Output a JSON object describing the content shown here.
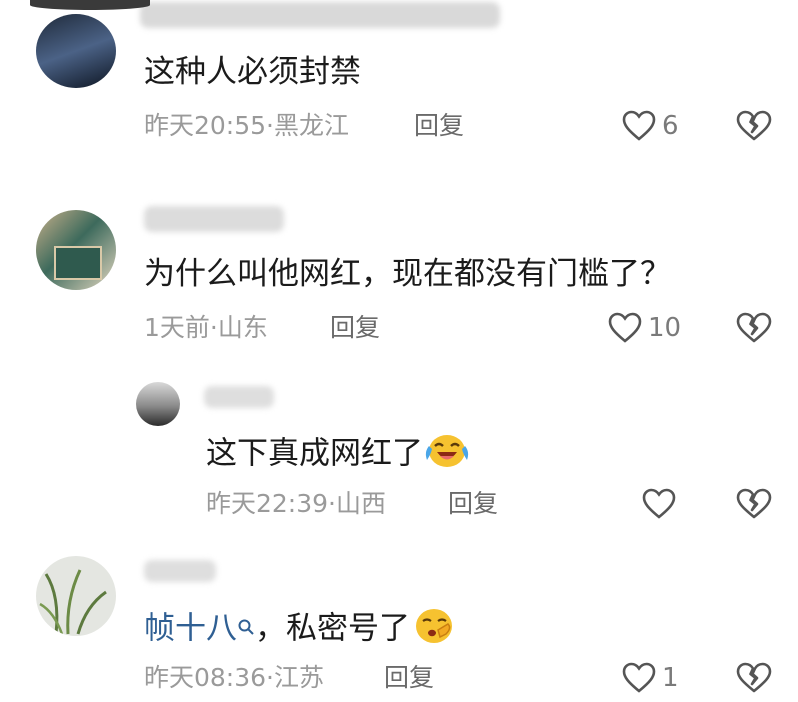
{
  "comments": [
    {
      "text": "这种人必须封禁",
      "meta": "昨天20:55·黑龙江",
      "reply": "回复",
      "likes": "6"
    },
    {
      "text": "为什么叫他网红，现在都没有门槛了？",
      "meta": "1天前·山东",
      "reply": "回复",
      "likes": "10"
    },
    {
      "text": "这下真成网红了",
      "meta": "昨天22:39·山西",
      "reply": "回复",
      "likes": ""
    },
    {
      "mention": "帧十八",
      "text": "，私密号了",
      "meta": "昨天08:36·江苏",
      "reply": "回复",
      "likes": "1"
    }
  ],
  "icons": {
    "like": "heart-outline-icon",
    "dislike": "broken-heart-icon",
    "mention": "search-lens-icon",
    "emoji_laugh": "laughing-crying-emoji",
    "emoji_shush": "shushing-face-emoji"
  },
  "colors": {
    "meta": "#9a9a9a",
    "mention": "#2f5f93",
    "text": "#1b1b1b"
  }
}
